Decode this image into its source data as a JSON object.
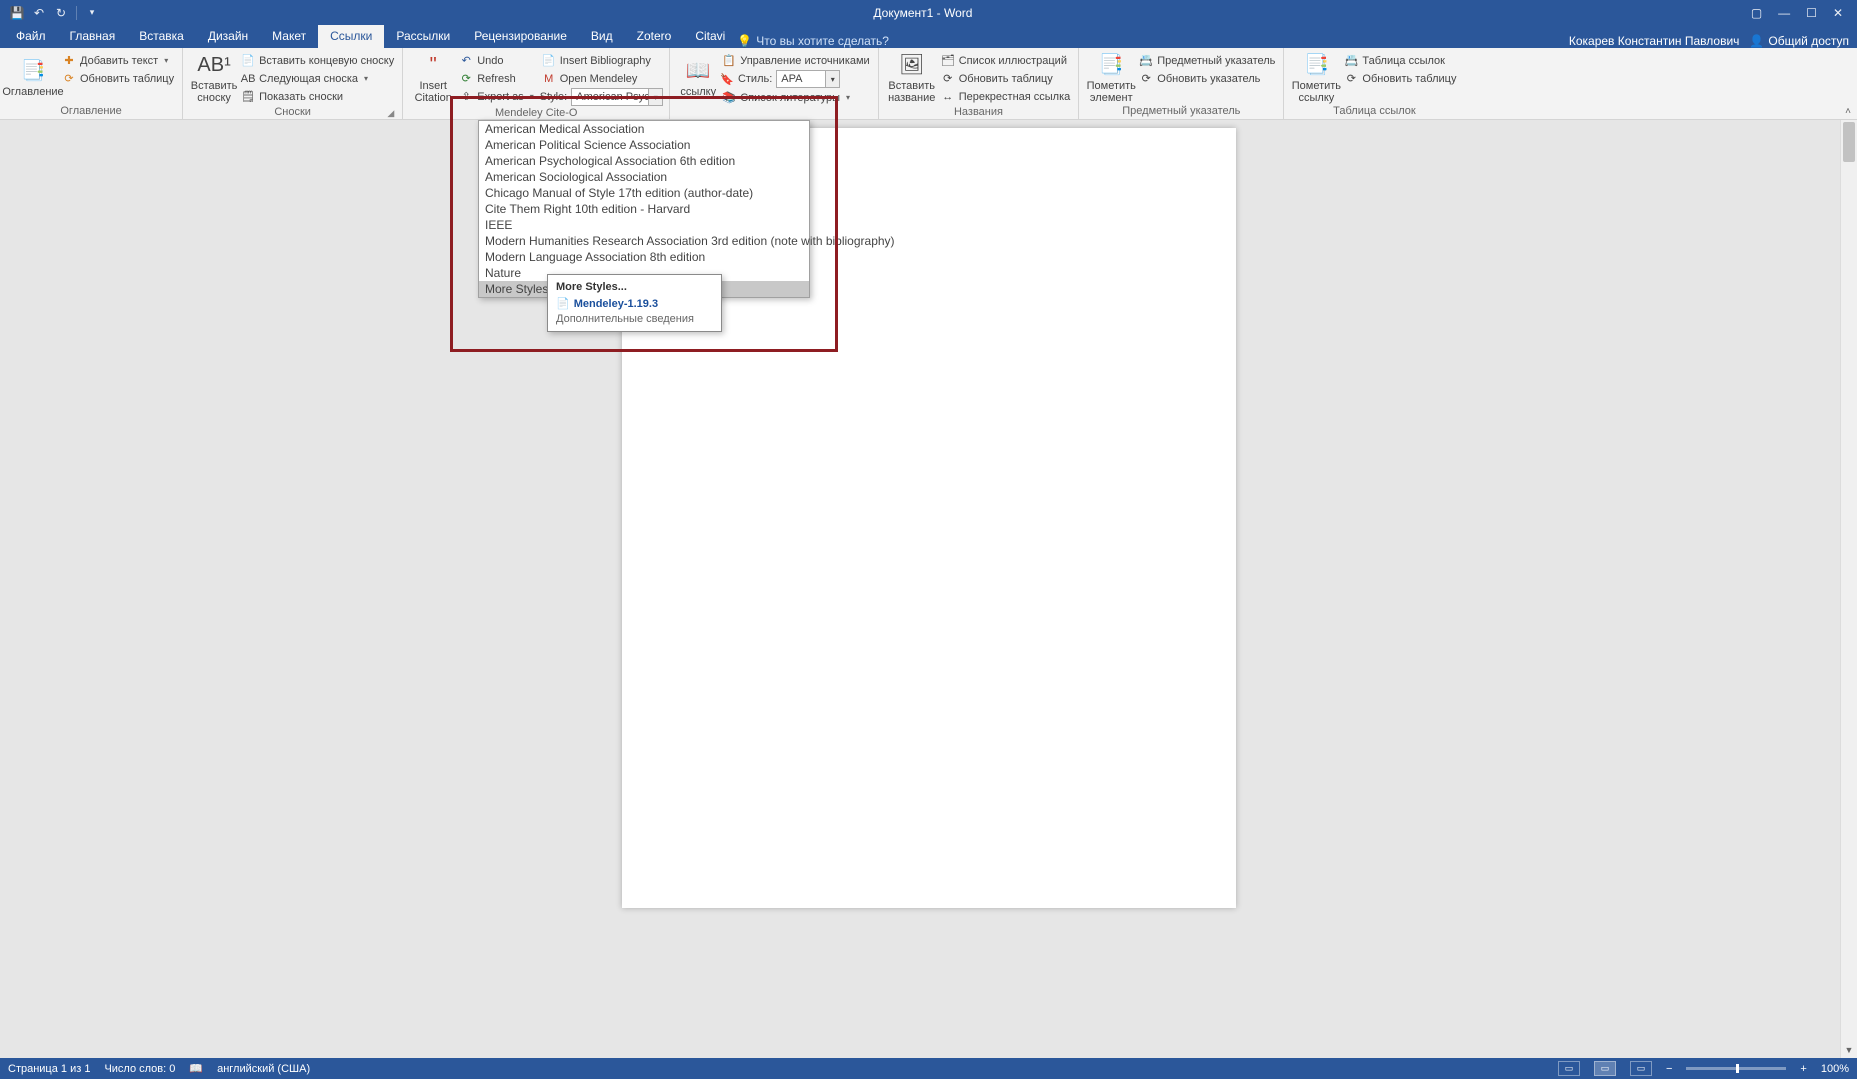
{
  "titlebar": {
    "document_title": "Документ1 - Word"
  },
  "user_name": "Кокарев Константин Павлович",
  "share_label": "Общий доступ",
  "tellme_placeholder": "Что вы хотите сделать?",
  "menu": {
    "file": "Файл",
    "home": "Главная",
    "insert": "Вставка",
    "design": "Дизайн",
    "layout": "Макет",
    "references": "Ссылки",
    "mailings": "Рассылки",
    "review": "Рецензирование",
    "view": "Вид",
    "zotero": "Zotero",
    "citavi": "Citavi"
  },
  "ribbon": {
    "toc": {
      "big": "Оглавление",
      "add_text": "Добавить текст",
      "update": "Обновить таблицу",
      "group": "Оглавление"
    },
    "footnotes": {
      "big": "Вставить сноску",
      "insert_endnote": "Вставить концевую сноску",
      "next_footnote": "Следующая сноска",
      "show_notes": "Показать сноски",
      "group": "Сноски"
    },
    "mendeley": {
      "big": "Insert Citation",
      "undo": "Undo",
      "refresh": "Refresh",
      "export": "Export as",
      "insert_bib": "Insert Bibliography",
      "open": "Open Mendeley",
      "style_label": "Style:",
      "style_value": "American Psych...",
      "group": "Mendeley Cite-O"
    },
    "citations": {
      "big_suffix": "ссылку",
      "manage": "Управление источниками",
      "style_label": "Стиль:",
      "style_value": "APA",
      "biblio": "Список литературы",
      "group": ""
    },
    "captions": {
      "big": "Вставить название",
      "list_figures": "Список иллюстраций",
      "update_table": "Обновить таблицу",
      "cross_ref": "Перекрестная ссылка",
      "group": "Названия"
    },
    "index": {
      "big": "Пометить элемент",
      "insert": "Предметный указатель",
      "update": "Обновить указатель",
      "group": "Предметный указатель"
    },
    "authorities": {
      "big": "Пометить ссылку",
      "table": "Таблица ссылок",
      "update": "Обновить таблицу",
      "group": "Таблица ссылок"
    }
  },
  "style_dropdown": {
    "items": [
      "American Medical Association",
      "American Political Science Association",
      "American Psychological Association 6th edition",
      "American Sociological Association",
      "Chicago Manual of Style 17th edition (author-date)",
      "Cite Them Right 10th edition - Harvard",
      "IEEE",
      "Modern Humanities Research Association 3rd edition (note with bibliography)",
      "Modern Language Association 8th edition",
      "Nature",
      "More Styles..."
    ]
  },
  "tooltip": {
    "header": "More Styles...",
    "program": "Mendeley-1.19.3",
    "more_info": "Дополнительные сведения"
  },
  "status": {
    "page": "Страница 1 из 1",
    "words": "Число слов: 0",
    "language": "английский (США)",
    "zoom": "100%"
  }
}
